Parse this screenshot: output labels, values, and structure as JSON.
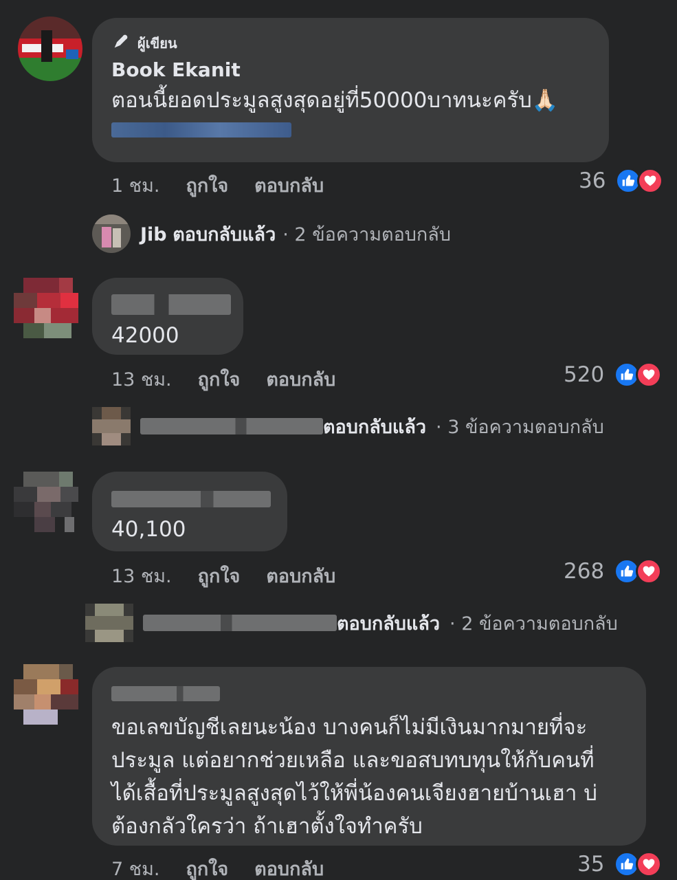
{
  "comments": [
    {
      "author_badge": "ผู้เขียน",
      "author_name": "Book Ekanit",
      "text": "ตอนนี้ยอดประมูลสูงสุดอยู่ที่50000บาทนะครับ🙏🏻",
      "time": "1 ชม.",
      "like_label": "ถูกใจ",
      "reply_label": "ตอบกลับ",
      "reaction_count": "36",
      "reply_summary": {
        "name": "Jib",
        "replied": "ตอบกลับแล้ว",
        "count_text": "· 2 ข้อความตอบกลับ"
      }
    },
    {
      "text": "42000",
      "time": "13 ชม.",
      "like_label": "ถูกใจ",
      "reply_label": "ตอบกลับ",
      "reaction_count": "520",
      "reply_summary": {
        "replied": "ตอบกลับแล้ว",
        "count_text": "· 3 ข้อความตอบกลับ"
      }
    },
    {
      "text": "40,100",
      "time": "13 ชม.",
      "like_label": "ถูกใจ",
      "reply_label": "ตอบกลับ",
      "reaction_count": "268",
      "reply_summary": {
        "replied": "ตอบกลับแล้ว",
        "count_text": "· 2 ข้อความตอบกลับ"
      }
    },
    {
      "text_lines": [
        "ขอเลขบัญชีเลยนะน้อง บางคนก็ไม่มีเงินมากมายที่จะ",
        "ประมูล แต่อยากช่วยเหลือ และขอสบทบทุนให้กับคนที่",
        "ได้เสื้อที่ประมูลสูงสุดไว้ให้พี่น้องคนเจียงฮายบ้านเฮา บ่",
        "ต้องกลัวใครว่า ถ้าเฮาตั้งใจทำครับ"
      ],
      "time": "7 ชม.",
      "like_label": "ถูกใจ",
      "reply_label": "ตอบกลับ",
      "reaction_count": "35"
    }
  ],
  "icons": {
    "badge": "pen-icon",
    "like": "like-icon",
    "love": "love-icon"
  },
  "colors": {
    "background": "#242526",
    "bubble": "#3a3b3c",
    "like": "#1877f2",
    "love": "#f33e58"
  }
}
